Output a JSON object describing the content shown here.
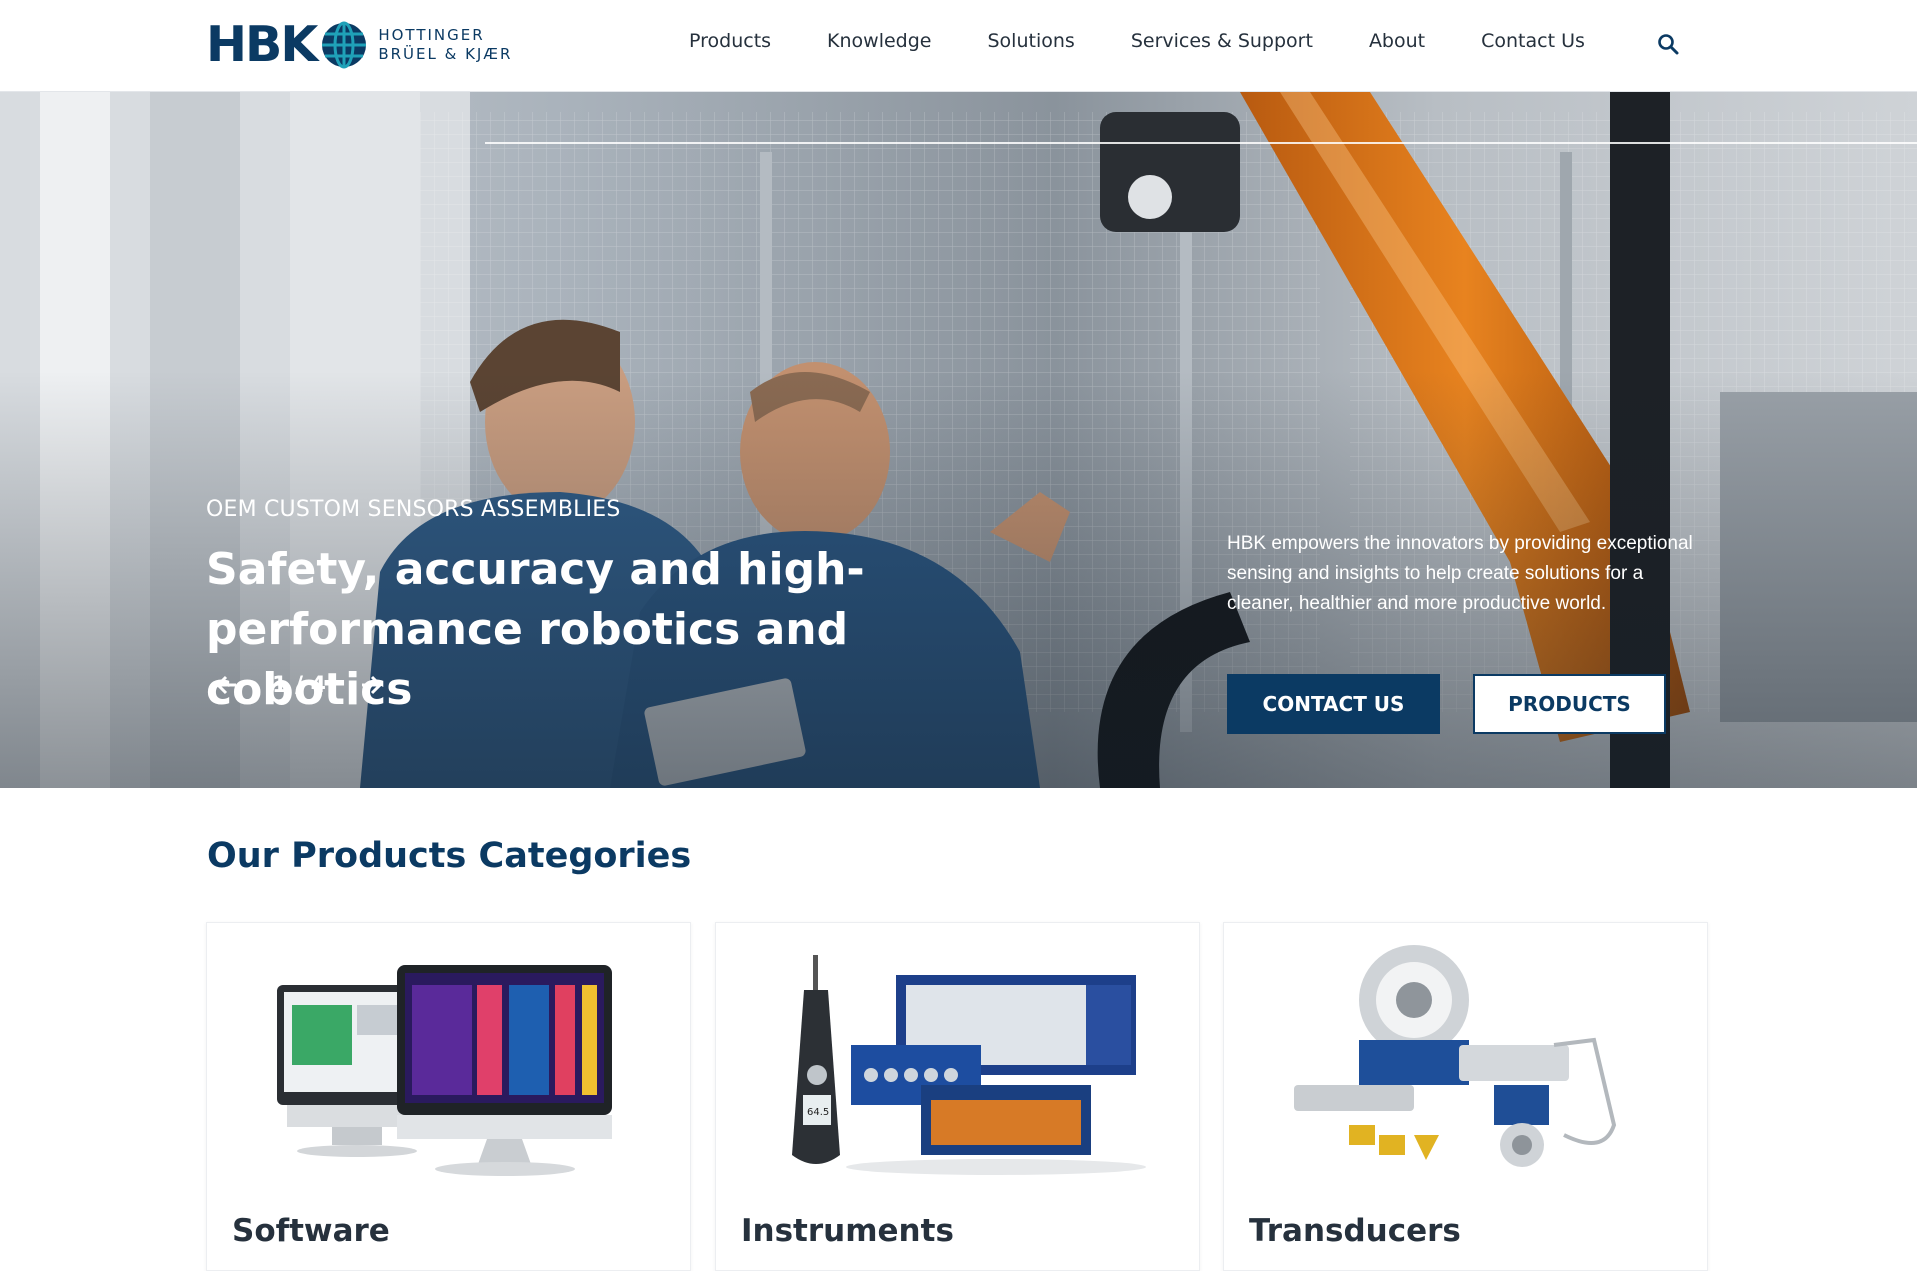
{
  "brand": {
    "logo_mark": "HBK",
    "logo_line1": "HOTTINGER",
    "logo_line2": "BRÜEL & KJÆR",
    "primary_color": "#0b3a63"
  },
  "nav": {
    "items": [
      {
        "label": "Products"
      },
      {
        "label": "Knowledge"
      },
      {
        "label": "Solutions"
      },
      {
        "label": "Services & Support"
      },
      {
        "label": "About"
      },
      {
        "label": "Contact Us"
      }
    ],
    "search_icon": "search-icon"
  },
  "hero": {
    "eyebrow": "OEM CUSTOM SENSORS ASSEMBLIES",
    "title": "Safety, accuracy and high-performance robotics and cobotics",
    "slide_counter": "1 / 4",
    "prev_icon": "arrow-left-icon",
    "next_icon": "arrow-right-icon",
    "description": "HBK empowers the innovators by providing exceptional sensing and insights to help create solutions for a cleaner, healthier and more productive world.",
    "primary_cta": "CONTACT US",
    "secondary_cta": "PRODUCTS"
  },
  "products": {
    "title": "Our Products Categories",
    "categories": [
      {
        "label": "Software",
        "image": "software-monitors"
      },
      {
        "label": "Instruments",
        "image": "instruments-devices"
      },
      {
        "label": "Transducers",
        "image": "transducers-sensors",
        "display_value": "64.5"
      }
    ]
  }
}
